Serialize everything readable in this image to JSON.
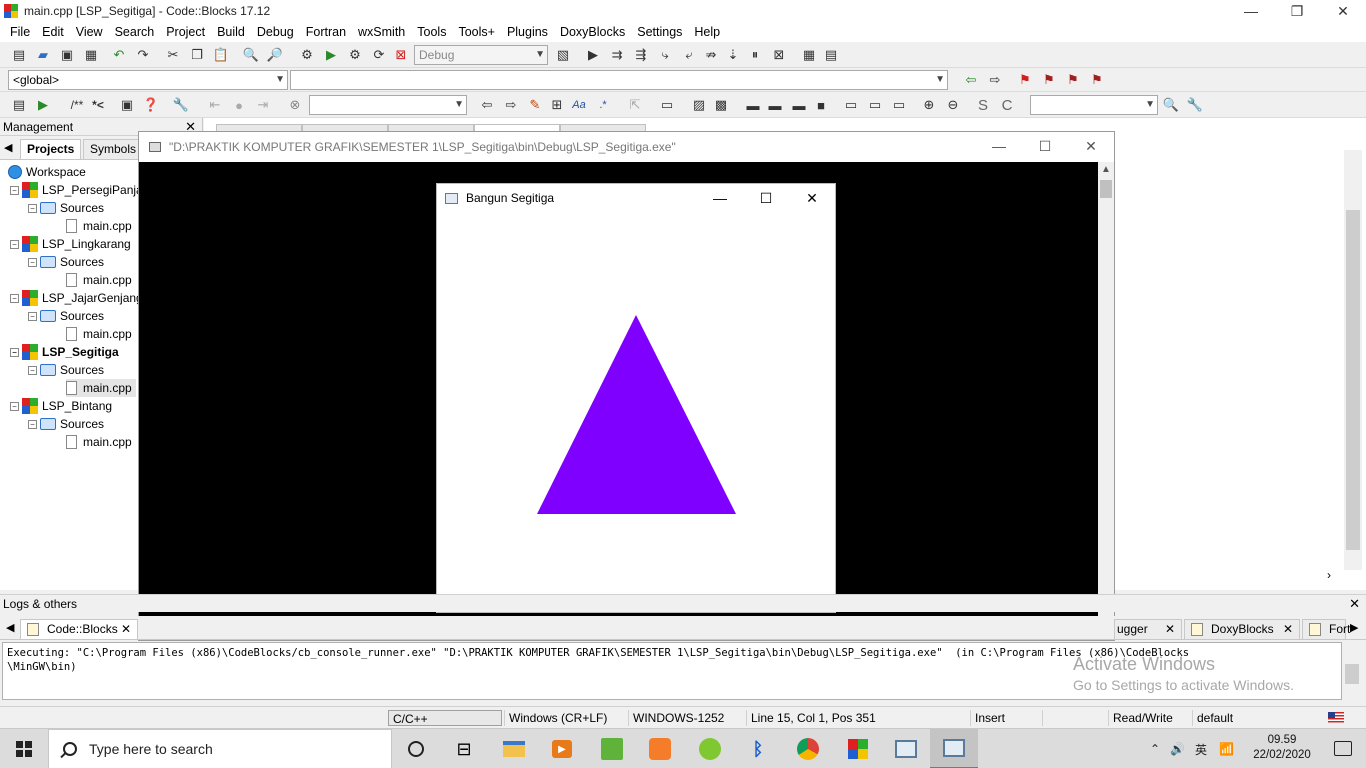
{
  "window": {
    "title": "main.cpp [LSP_Segitiga] - Code::Blocks 17.12",
    "minimize": "—",
    "restore": "❐",
    "close": "✕"
  },
  "menu": [
    "File",
    "Edit",
    "View",
    "Search",
    "Project",
    "Build",
    "Debug",
    "Fortran",
    "wxSmith",
    "Tools",
    "Tools+",
    "Plugins",
    "DoxyBlocks",
    "Settings",
    "Help"
  ],
  "toolbar": {
    "build_target": "Debug",
    "scope": "<global>",
    "doc_comment": "/**",
    "doc_line": "*<",
    "search_field": "",
    "regex_label": ".*",
    "s_label": "S",
    "c_label": "C"
  },
  "management": {
    "title": "Management",
    "close": "✕",
    "tabs": [
      "Projects",
      "Symbols"
    ],
    "workspace": "Workspace",
    "projects": [
      {
        "name": "LSP_PersegiPanja",
        "folder": "Sources",
        "file": "main.cpp"
      },
      {
        "name": "LSP_Lingkarang",
        "folder": "Sources",
        "file": "main.cpp"
      },
      {
        "name": "LSP_JajarGenjang",
        "folder": "Sources",
        "file": "main.cpp"
      },
      {
        "name": "LSP_Segitiga",
        "folder": "Sources",
        "file": "main.cpp"
      },
      {
        "name": "LSP_Bintang",
        "folder": "Sources",
        "file": "main.cpp"
      }
    ]
  },
  "console": {
    "title": "\"D:\\PRAKTIK KOMPUTER GRAFIK\\SEMESTER 1\\LSP_Segitiga\\bin\\Debug\\LSP_Segitiga.exe\"",
    "minimize": "—",
    "maximize": "☐",
    "close": "✕"
  },
  "glut": {
    "title": "Bangun Segitiga",
    "minimize": "—",
    "maximize": "☐",
    "close": "✕",
    "triangle_color": "#8000ff"
  },
  "logs": {
    "title": "Logs & others",
    "close": "✕",
    "tabs": [
      {
        "label": "Code::Blocks"
      },
      {
        "label": "ugger"
      },
      {
        "label": "DoxyBlocks"
      },
      {
        "label": "Fort"
      }
    ],
    "output": "Executing: \"C:\\Program Files (x86)\\CodeBlocks/cb_console_runner.exe\" \"D:\\PRAKTIK KOMPUTER GRAFIK\\SEMESTER 1\\LSP_Segitiga\\bin\\Debug\\LSP_Segitiga.exe\"  (in C:\\Program Files (x86)\\CodeBlocks\n\\MinGW\\bin)",
    "activate_line1": "Activate Windows",
    "activate_line2": "Go to Settings to activate Windows."
  },
  "status": {
    "language": "C/C++",
    "line_endings": "Windows (CR+LF)",
    "encoding": "WINDOWS-1252",
    "position": "Line 15, Col 1, Pos 351",
    "mode": "Insert",
    "access": "Read/Write",
    "profile": "default"
  },
  "taskbar": {
    "search_placeholder": "Type here to search",
    "tray_volume": "🔊",
    "tray_ime": "英",
    "time": "09.59",
    "date": "22/02/2020"
  },
  "colors": {
    "triangle": "#8000ff",
    "console_bg": "#000000"
  }
}
